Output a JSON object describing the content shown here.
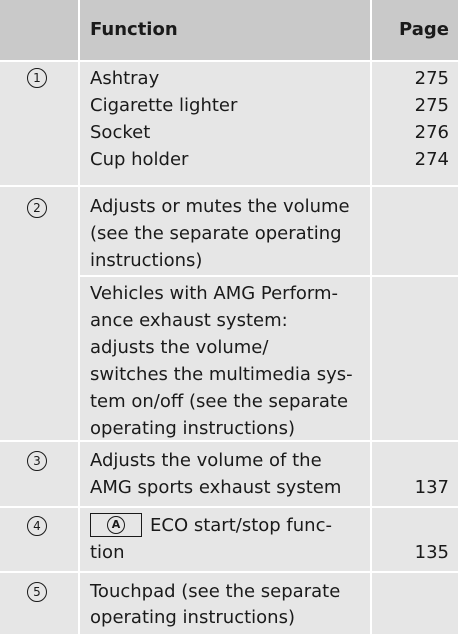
{
  "header": {
    "function_label": "Function",
    "page_label": "Page"
  },
  "rows": [
    {
      "number": "1",
      "items": [
        {
          "text": "Ashtray",
          "page": "275"
        },
        {
          "text": "Cigarette lighter",
          "page": "275"
        },
        {
          "text": "Socket",
          "page": "276"
        },
        {
          "text": "Cup holder",
          "page": "274"
        }
      ]
    },
    {
      "number": "2",
      "block1_lines": [
        "Adjusts or mutes the volume",
        "(see the separate operating",
        "instructions)"
      ],
      "block2_lines": [
        "Vehicles with AMG Perform-",
        "ance exhaust system:",
        "adjusts the volume/",
        "switches the multimedia sys-",
        "tem on/off (see the separate",
        "operating instructions)"
      ]
    },
    {
      "number": "3",
      "lines": [
        "Adjusts the volume of the",
        "AMG sports exhaust system"
      ],
      "page": "137"
    },
    {
      "number": "4",
      "key_symbol": "A",
      "lines": [
        "ECO start/stop func-",
        "tion"
      ],
      "page": "135"
    },
    {
      "number": "5",
      "lines": [
        "Touchpad (see the separate",
        "operating instructions)"
      ]
    }
  ]
}
